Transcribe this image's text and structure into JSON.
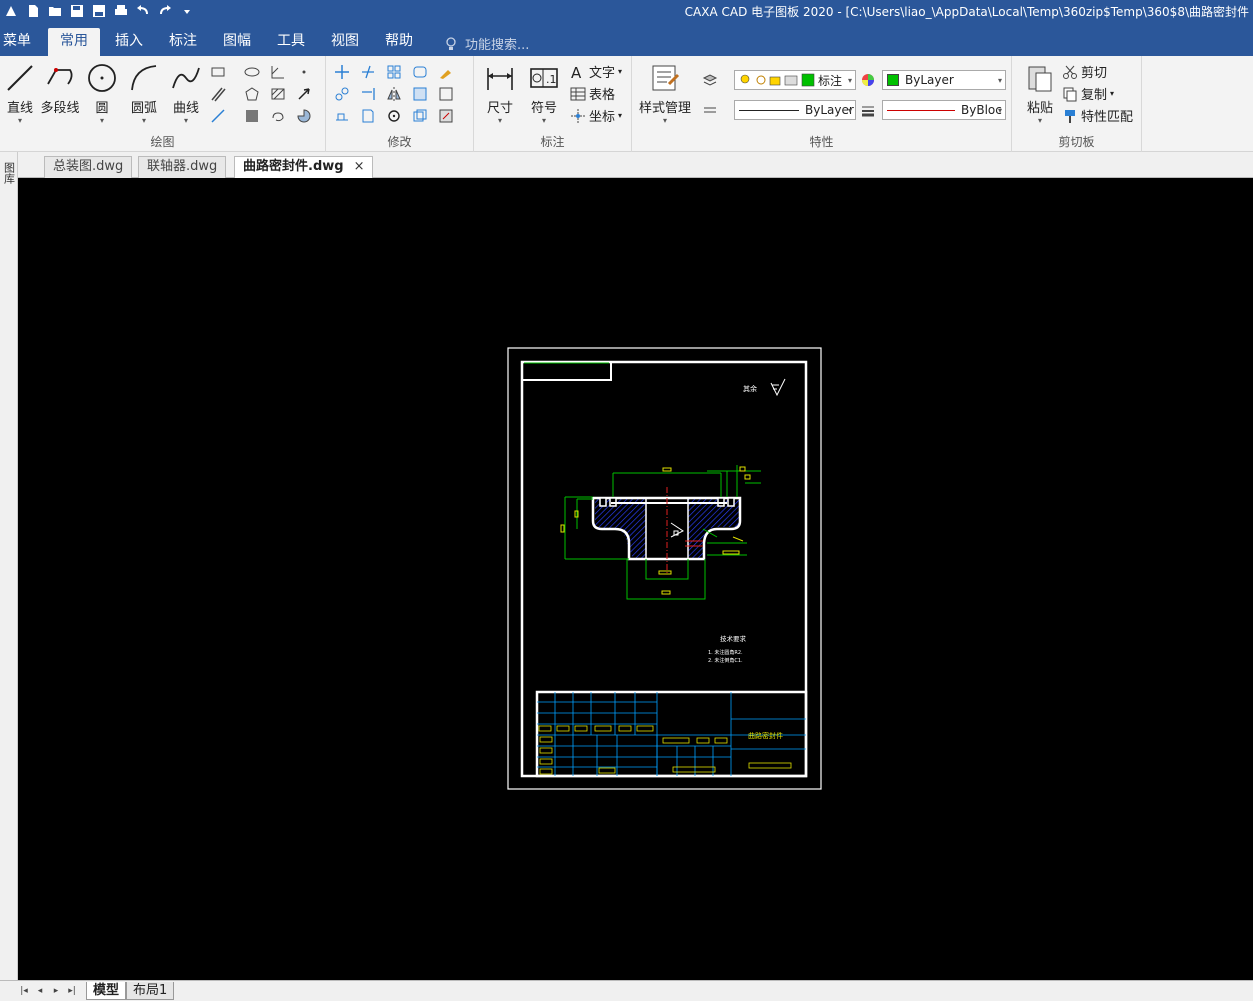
{
  "window": {
    "title": "CAXA CAD 电子图板 2020 - [C:\\Users\\liao_\\AppData\\Local\\Temp\\360zip$Temp\\360$8\\曲路密封件"
  },
  "menu": {
    "tabs": [
      "菜单",
      "常用",
      "插入",
      "标注",
      "图幅",
      "工具",
      "视图",
      "帮助"
    ],
    "active": "常用",
    "search_placeholder": "功能搜索..."
  },
  "ribbon": {
    "draw": {
      "label": "绘图",
      "buttons": [
        "直线",
        "多段线",
        "圆",
        "圆弧",
        "曲线"
      ]
    },
    "modify": {
      "label": "修改"
    },
    "annotate": {
      "label": "标注",
      "buttons": [
        "尺寸",
        "符号"
      ],
      "small": [
        "文字",
        "表格",
        "坐标"
      ]
    },
    "properties": {
      "label": "特性",
      "style_button": "样式管理",
      "layer_value": "标注",
      "color_value": "ByLayer",
      "linetype_value": "ByLayer",
      "lineweight_value": "ByBloc",
      "colors": {
        "layer_color": "#00c000",
        "linetype_red": "#cc0000"
      }
    },
    "clipboard": {
      "label": "剪切板",
      "paste": "粘贴",
      "small": [
        "剪切",
        "复制",
        "特性匹配"
      ]
    }
  },
  "doc_tabs": {
    "items": [
      "总装图.dwg",
      "联轴器.dwg",
      "曲路密封件.dwg"
    ],
    "active": "曲路密封件.dwg",
    "close_glyph": "×"
  },
  "left_strip": {
    "label": "图库"
  },
  "drawing": {
    "roughness_note": "其余",
    "tech_title": "技术要求",
    "tech_items": [
      "1. 未注圆角R2.",
      "2. 未注倒角C1."
    ],
    "part_name": "曲路密封件"
  },
  "sheets": {
    "items": [
      "模型",
      "布局1"
    ],
    "active": "模型"
  }
}
